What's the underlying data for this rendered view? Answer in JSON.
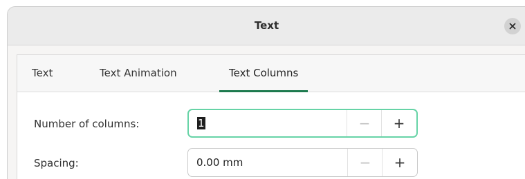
{
  "dialog": {
    "title": "Text",
    "close_icon": "close-icon"
  },
  "tabs": [
    {
      "label": "Text",
      "active": false
    },
    {
      "label": "Text Animation",
      "active": false
    },
    {
      "label": "Text Columns",
      "active": true
    }
  ],
  "fields": {
    "columns": {
      "label": "Number of columns:",
      "value": "1",
      "decrement": "−",
      "increment": "+"
    },
    "spacing": {
      "label": "Spacing:",
      "value": "0.00 mm",
      "decrement": "−",
      "increment": "+"
    }
  },
  "colors": {
    "accent": "#1d7a4e",
    "focus_ring": "#66d3a6"
  }
}
